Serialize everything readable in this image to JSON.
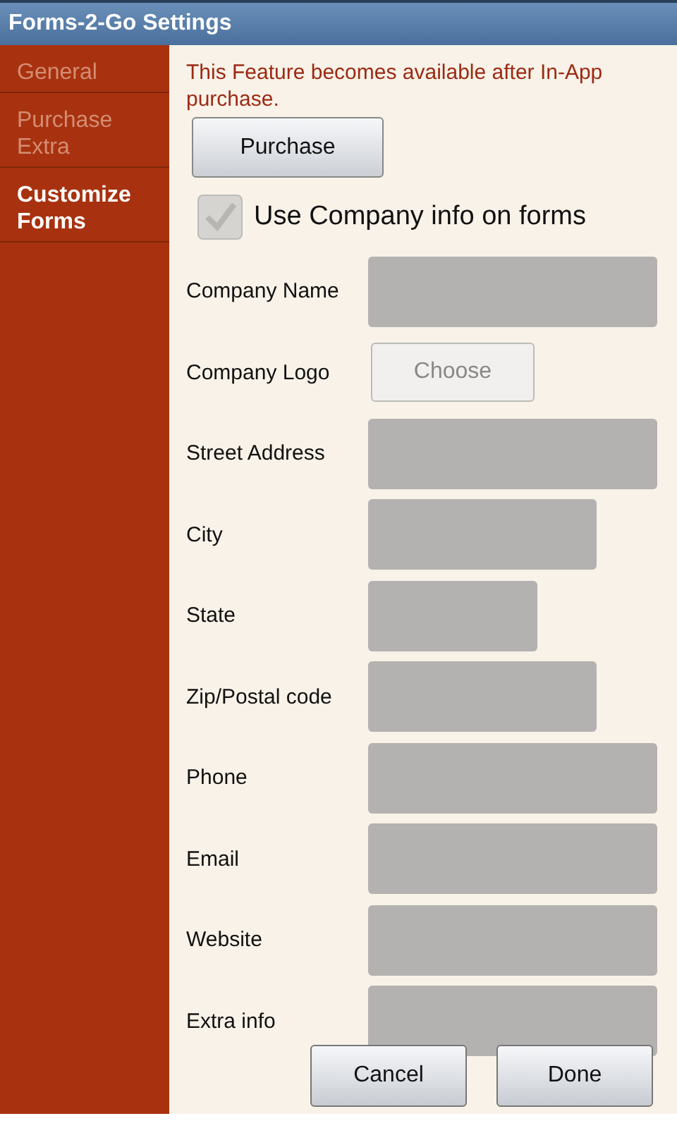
{
  "window": {
    "title": "Forms-2-Go Settings"
  },
  "sidebar": {
    "items": [
      {
        "label": "General",
        "selected": false
      },
      {
        "label": "Purchase Extra",
        "selected": false
      },
      {
        "label": "Customize Forms",
        "selected": true
      }
    ]
  },
  "notice": "This Feature becomes available after In-App purchase.",
  "purchase_button": "Purchase",
  "use_company_info": {
    "label": "Use Company info on forms",
    "checked": true,
    "disabled": true
  },
  "fields": [
    {
      "label": "Company Name",
      "kind": "long"
    },
    {
      "label": "Company Logo",
      "kind": "choose",
      "button": "Choose"
    },
    {
      "label": "Street Address",
      "kind": "long"
    },
    {
      "label": "City",
      "kind": "medium"
    },
    {
      "label": "State",
      "kind": "short"
    },
    {
      "label": "Zip/Postal code",
      "kind": "medium"
    },
    {
      "label": "Phone",
      "kind": "long"
    },
    {
      "label": "Email",
      "kind": "long"
    },
    {
      "label": "Website",
      "kind": "long"
    },
    {
      "label": "Extra info",
      "kind": "long"
    }
  ],
  "buttons": [
    {
      "label": "Cancel"
    },
    {
      "label": "Done"
    }
  ]
}
